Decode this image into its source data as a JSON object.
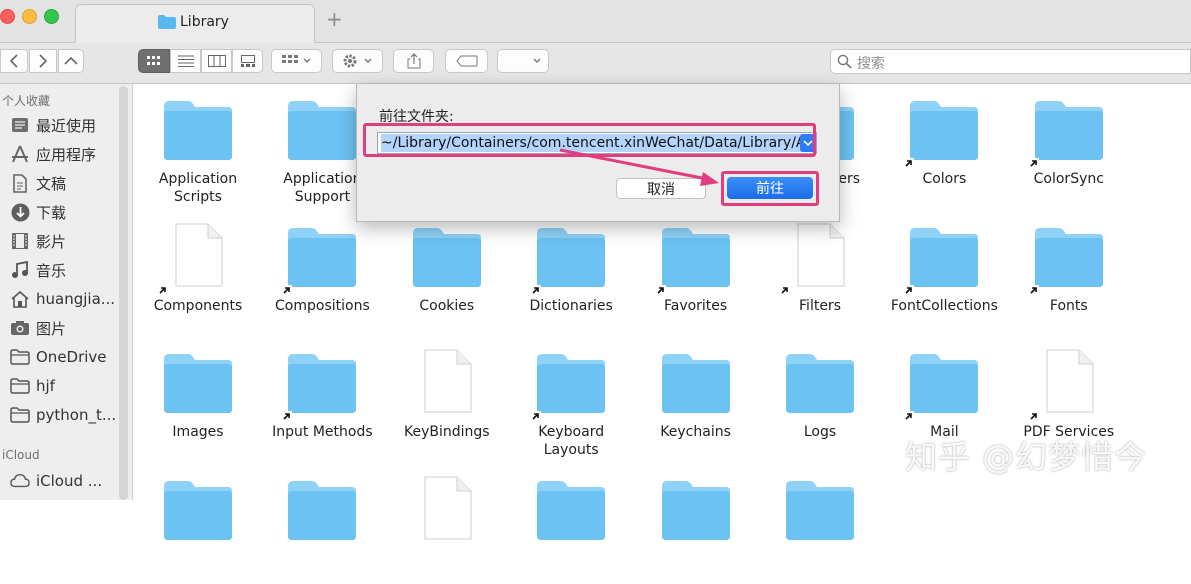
{
  "window": {
    "tab_title": "Library",
    "new_tab": "+"
  },
  "toolbar": {
    "search_placeholder": "搜索"
  },
  "sidebar": {
    "favorites_header": "个人收藏",
    "favorites": [
      {
        "label": "最近使用",
        "icon": "clock-icon"
      },
      {
        "label": "应用程序",
        "icon": "applications-icon"
      },
      {
        "label": "文稿",
        "icon": "document-icon"
      },
      {
        "label": "下载",
        "icon": "download-icon"
      },
      {
        "label": "影片",
        "icon": "film-icon"
      },
      {
        "label": "音乐",
        "icon": "music-icon"
      },
      {
        "label": "huangjia...",
        "icon": "home-icon"
      },
      {
        "label": "图片",
        "icon": "camera-icon"
      },
      {
        "label": "OneDrive",
        "icon": "folder-icon"
      },
      {
        "label": "hjf",
        "icon": "folder-icon"
      },
      {
        "label": "python_t...",
        "icon": "folder-icon"
      }
    ],
    "icloud_header": "iCloud",
    "icloud": [
      {
        "label": "iCloud ...",
        "icon": "cloud-icon"
      }
    ]
  },
  "files": [
    {
      "name": "Application Scripts",
      "type": "folder"
    },
    {
      "name": "Application Support",
      "type": "folder"
    },
    {
      "name": "",
      "type": "folder"
    },
    {
      "name": "",
      "type": "folder"
    },
    {
      "name": "",
      "type": "folder"
    },
    {
      "name": "ers",
      "type": "folder"
    },
    {
      "name": "Colors",
      "type": "folder-alias"
    },
    {
      "name": "ColorSync",
      "type": "folder-alias"
    },
    {
      "name": "Components",
      "type": "file-alias"
    },
    {
      "name": "Compositions",
      "type": "folder-alias"
    },
    {
      "name": "Cookies",
      "type": "folder"
    },
    {
      "name": "Dictionaries",
      "type": "folder-alias"
    },
    {
      "name": "Favorites",
      "type": "folder-alias"
    },
    {
      "name": "Filters",
      "type": "file-alias"
    },
    {
      "name": "FontCollections",
      "type": "folder-alias"
    },
    {
      "name": "Fonts",
      "type": "folder-alias"
    },
    {
      "name": "Images",
      "type": "folder"
    },
    {
      "name": "Input Methods",
      "type": "folder-alias"
    },
    {
      "name": "KeyBindings",
      "type": "file"
    },
    {
      "name": "Keyboard Layouts",
      "type": "folder-alias"
    },
    {
      "name": "Keychains",
      "type": "folder"
    },
    {
      "name": "Logs",
      "type": "folder"
    },
    {
      "name": "Mail",
      "type": "folder-alias"
    },
    {
      "name": "PDF Services",
      "type": "file-alias"
    }
  ],
  "dialog": {
    "title": "前往文件夹:",
    "path_value": "~/Library/Containers/com.tencent.xinWeChat/Data/Library/Ap",
    "cancel_label": "取消",
    "go_label": "前往",
    "dropdown": "v"
  },
  "watermark": "知乎 @幻梦惜今",
  "colors": {
    "folder": "#6cc3f3",
    "folder_tab": "#8fd2f7",
    "highlight": "#e23d7e",
    "primary_button": "#2d7bf4"
  }
}
